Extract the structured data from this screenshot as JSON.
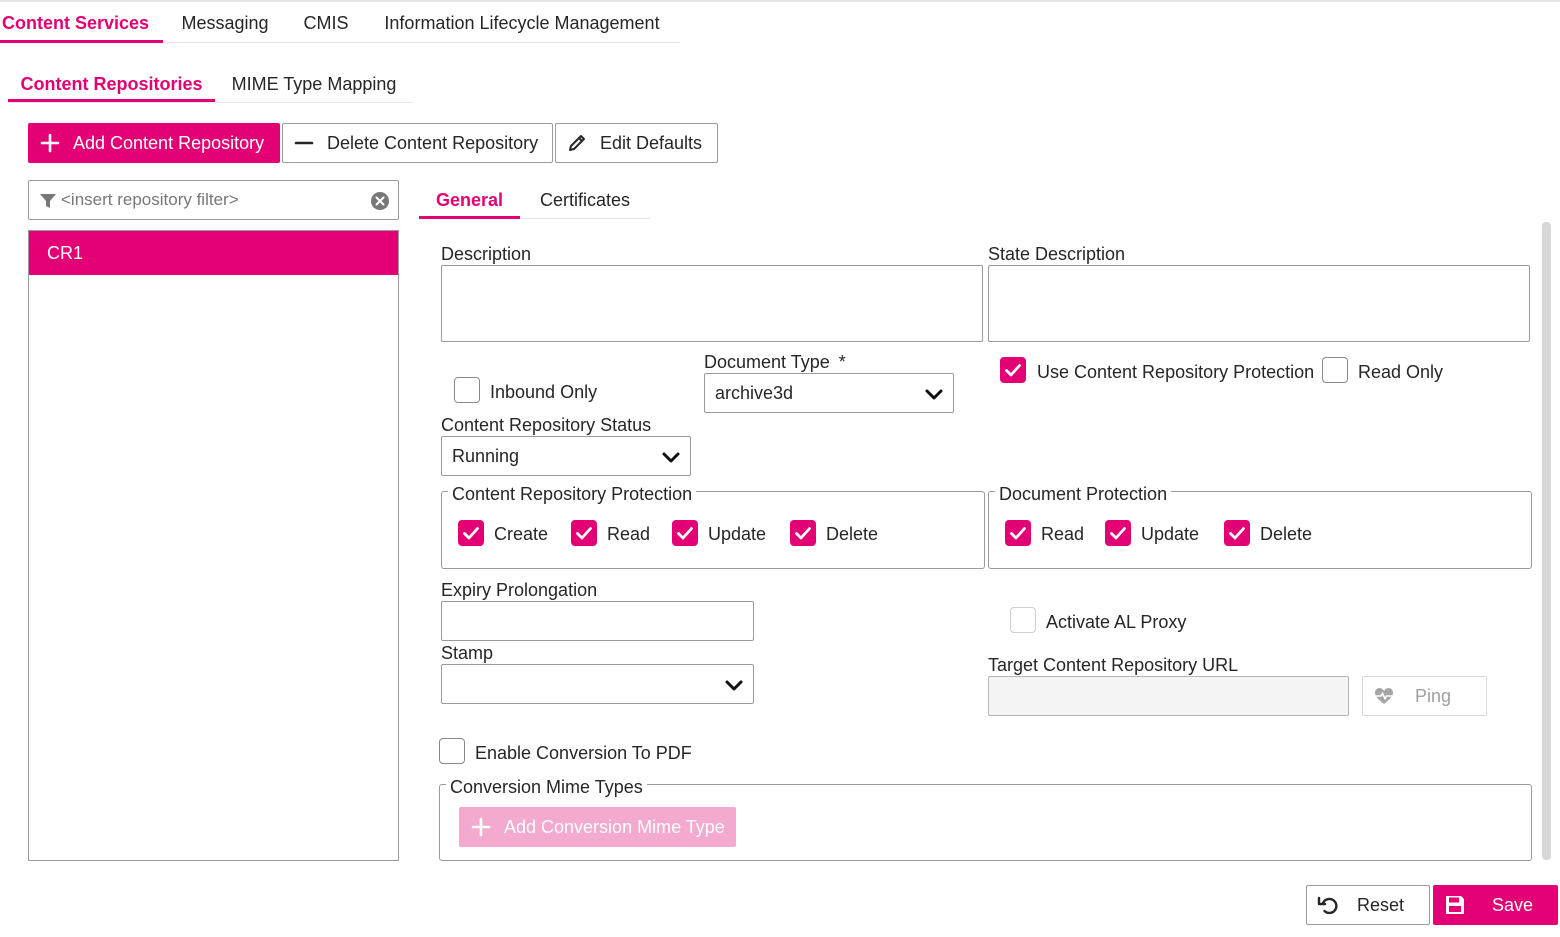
{
  "main_tabs": [
    {
      "label": "Content Services",
      "active": true
    },
    {
      "label": "Messaging",
      "active": false
    },
    {
      "label": "CMIS",
      "active": false
    },
    {
      "label": "Information Lifecycle Management",
      "active": false
    }
  ],
  "sub_tabs": [
    {
      "label": "Content Repositories",
      "active": true
    },
    {
      "label": "MIME Type Mapping",
      "active": false
    }
  ],
  "toolbar": {
    "add_label": "Add Content Repository",
    "delete_label": "Delete Content Repository",
    "edit_label": "Edit Defaults"
  },
  "filter": {
    "placeholder": "<insert repository filter>",
    "value": ""
  },
  "repositories": [
    {
      "name": "CR1",
      "selected": true
    }
  ],
  "detail_tabs": [
    {
      "label": "General",
      "active": true
    },
    {
      "label": "Certificates",
      "active": false
    }
  ],
  "form": {
    "description_label": "Description",
    "description_value": "",
    "state_description_label": "State Description",
    "state_description_value": "",
    "inbound_only_label": "Inbound Only",
    "inbound_only_checked": false,
    "document_type_label": "Document Type",
    "required_marker": "*",
    "document_type_value": "archive3d",
    "use_protection_label": "Use Content Repository Protection",
    "use_protection_checked": true,
    "read_only_label": "Read Only",
    "read_only_checked": false,
    "status_label": "Content Repository Status",
    "status_value": "Running",
    "cr_protection": {
      "legend": "Content Repository Protection",
      "create_label": "Create",
      "read_label": "Read",
      "update_label": "Update",
      "delete_label": "Delete"
    },
    "doc_protection": {
      "legend": "Document Protection",
      "read_label": "Read",
      "update_label": "Update",
      "delete_label": "Delete"
    },
    "expiry_label": "Expiry Prolongation",
    "expiry_value": "",
    "activate_proxy_label": "Activate AL Proxy",
    "activate_proxy_checked": false,
    "stamp_label": "Stamp",
    "stamp_value": "",
    "target_url_label": "Target Content Repository URL",
    "target_url_value": "",
    "ping_label": "Ping",
    "enable_pdf_label": "Enable Conversion To PDF",
    "enable_pdf_checked": false,
    "conversion_legend": "Conversion Mime Types",
    "add_conversion_label": "Add Conversion Mime Type"
  },
  "footer": {
    "reset_label": "Reset",
    "save_label": "Save"
  },
  "colors": {
    "accent": "#e20074",
    "accent_disabled": "#f4a9cf",
    "border": "#9a9a9a"
  }
}
